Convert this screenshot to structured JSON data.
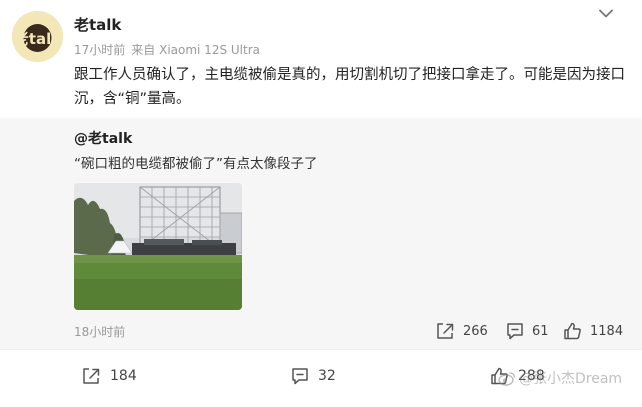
{
  "post": {
    "avatar_label": "老talk",
    "author": "老talk",
    "time": "17小时前",
    "source": "来自 Xiaomi 12S Ultra",
    "text": "跟工作人员确认了，主电缆被偷是真的，用切割机切了把接口拿走了。可能是因为接口沉，含“铜”量高。"
  },
  "quote": {
    "author": "@老talk",
    "text": "“碗口粗的电缆都被偷了”有点太像段子了",
    "time": "18小时前",
    "reposts": "266",
    "comments": "61",
    "likes": "1184"
  },
  "footer": {
    "reposts": "184",
    "comments": "32",
    "likes": "288"
  },
  "watermark": "@张小杰Dream",
  "icons": {
    "chevron": "chevron-down-icon",
    "repost": "repost-icon",
    "comment": "comment-icon",
    "like": "like-icon",
    "weibo": "weibo-logo-icon"
  },
  "colors": {
    "text": "#222222",
    "meta": "#999999",
    "quote_bg": "#f6f6f6",
    "icon": "#555555"
  }
}
